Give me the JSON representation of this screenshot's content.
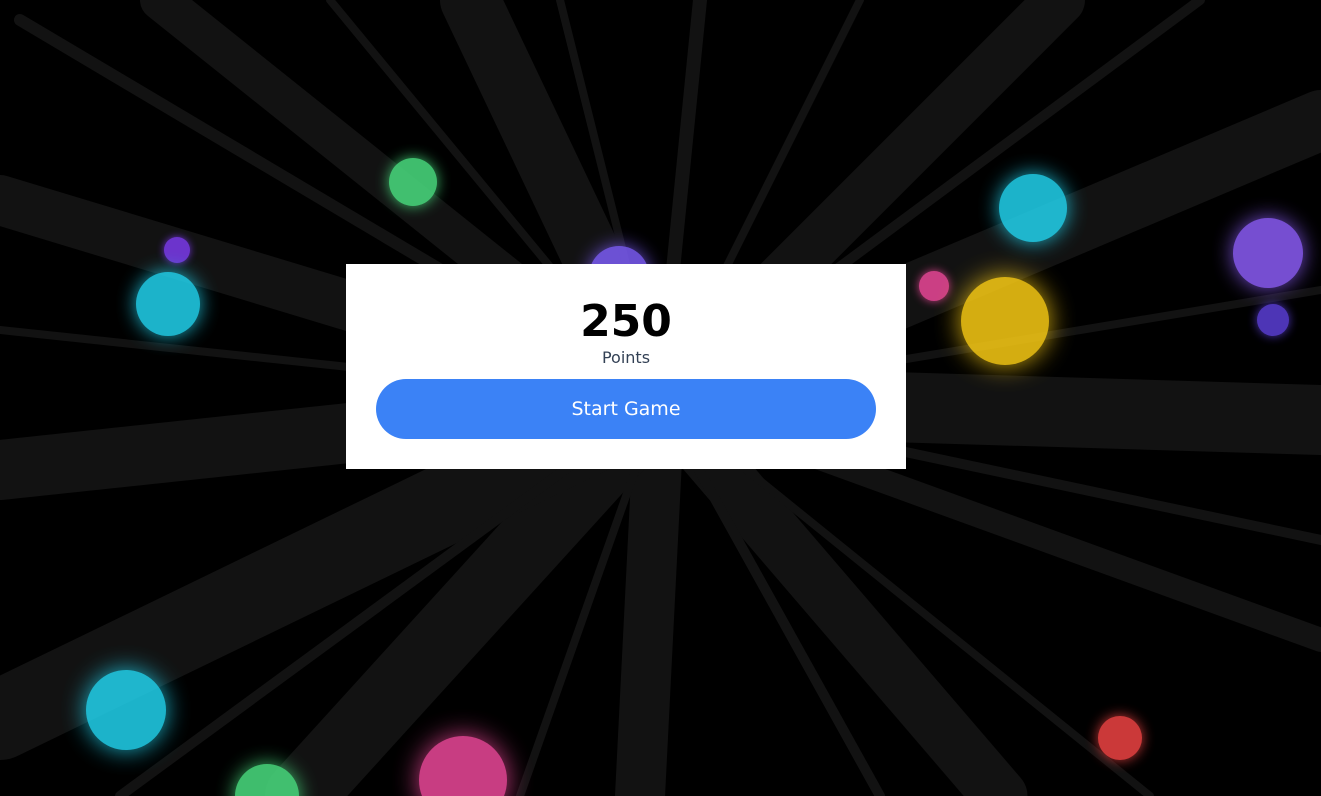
{
  "score": {
    "value": "250",
    "label": "Points"
  },
  "start_button": {
    "label": "Start Game"
  },
  "colors": {
    "background": "#000000",
    "streak": "#111111",
    "panel": "#ffffff",
    "button": "#3b82f6",
    "button_text": "#ffffff"
  },
  "particles": [
    {
      "color": "#4ade80"
    },
    {
      "color": "#22d3ee"
    },
    {
      "color": "#7c3aed"
    },
    {
      "color": "#22d3ee"
    },
    {
      "color": "#ec4899"
    },
    {
      "color": "#facc15"
    },
    {
      "color": "#8b5cf6"
    },
    {
      "color": "#5b3fd6"
    },
    {
      "color": "#7c5cf6"
    },
    {
      "color": "#22d3ee"
    },
    {
      "color": "#4ade80"
    },
    {
      "color": "#ec4899"
    },
    {
      "color": "#ef4444"
    },
    {
      "color": "#4ade80"
    }
  ]
}
